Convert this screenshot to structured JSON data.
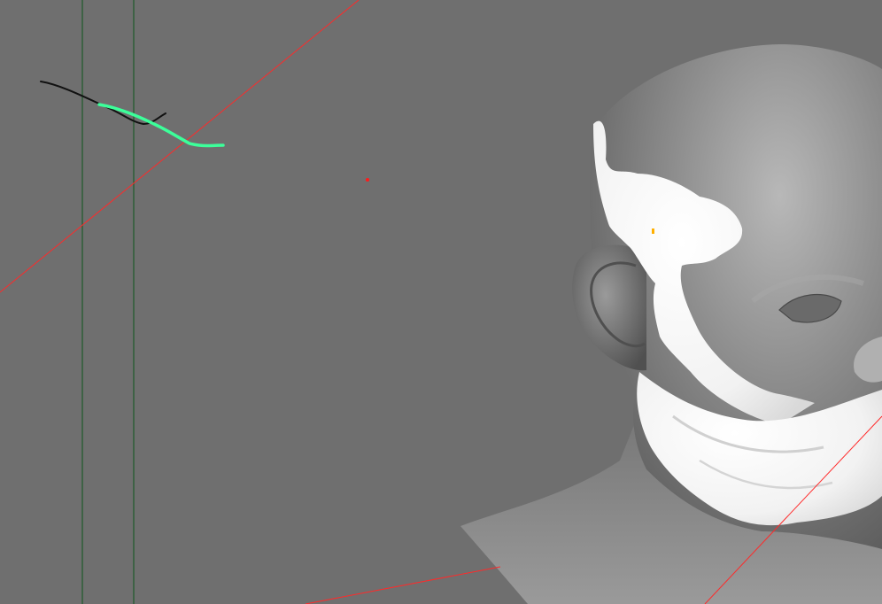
{
  "viewport": {
    "background_color": "#6f6f6f",
    "guide_line_green": "#1f5a2a",
    "guide_line_red": "#ff2a2a",
    "curve_black": "#111111",
    "curve_highlight": "#3cff9a"
  },
  "scene": {
    "model_skin_color": "#8a8a8a",
    "model_mask_color": "#f3f3f3",
    "pivot_color": "#ff1a1a",
    "marker_color": "#ffb000"
  }
}
